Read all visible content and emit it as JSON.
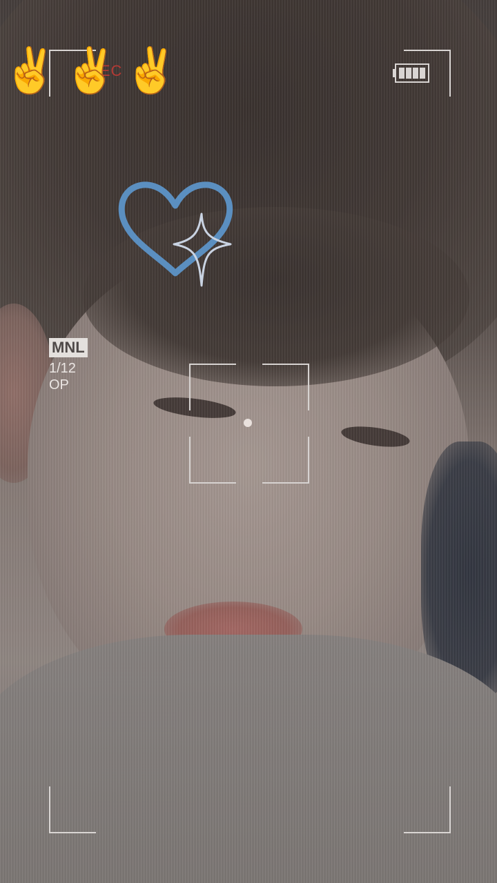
{
  "camera_overlay": {
    "emoji_sticker": "✌️✌️✌️",
    "rec_label": "REC",
    "mode_badge": "MNL",
    "shutter_speed": "1/12",
    "status_text": "OP",
    "battery_level_bars": 4
  },
  "sticker": {
    "icon": "heart-sparkle-icon",
    "color": "#5b8fc0"
  },
  "colors": {
    "overlay_white": "#d9d5d3",
    "rec_red": "#b33a35"
  }
}
